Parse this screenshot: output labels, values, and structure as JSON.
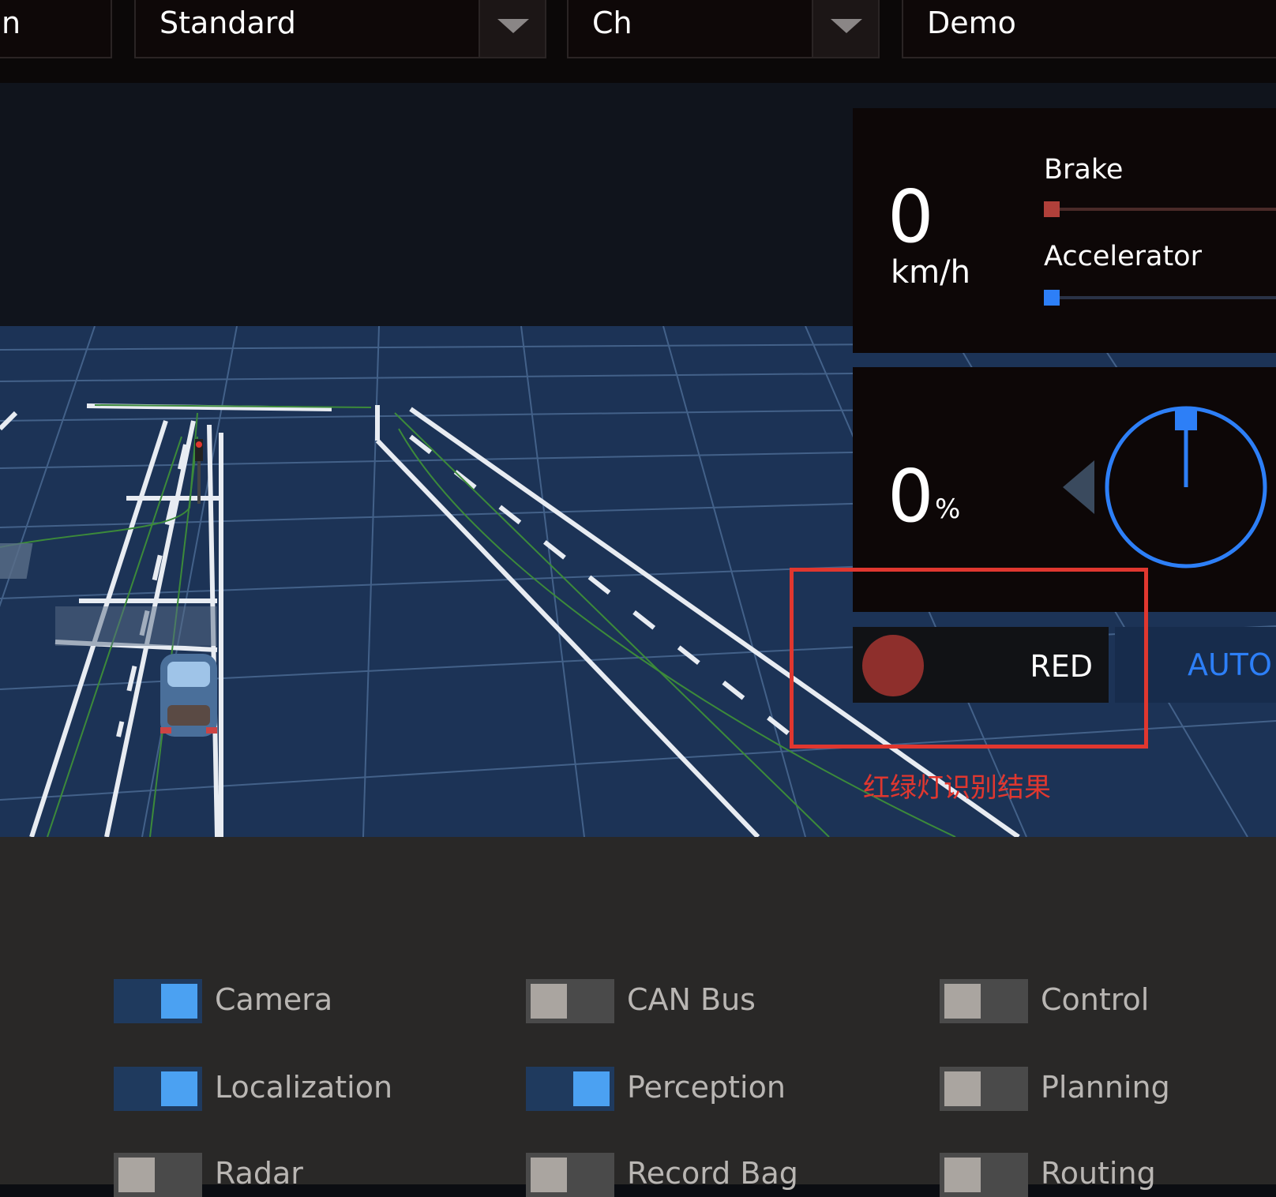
{
  "header": {
    "dropdowns": [
      {
        "id": "mode",
        "value": "n"
      },
      {
        "id": "vehicle",
        "value": "Standard"
      },
      {
        "id": "map",
        "value": "Ch"
      },
      {
        "id": "scenario",
        "value": "Demo"
      }
    ]
  },
  "dashboard": {
    "speed": {
      "value": "0",
      "unit": "km/h"
    },
    "brake": {
      "label": "Brake",
      "level": 0
    },
    "accelerator": {
      "label": "Accelerator",
      "level": 0
    },
    "steering": {
      "value": "0",
      "unit": "%"
    },
    "traffic_light": {
      "status": "RED",
      "color": "#8e2f2c"
    },
    "driving_mode": "AUTO"
  },
  "annotation": {
    "label": "红绿灯识别结果",
    "color": "#e0372f"
  },
  "modules": [
    {
      "name": "Camera",
      "on": true
    },
    {
      "name": "CAN Bus",
      "on": false
    },
    {
      "name": "Control",
      "on": false
    },
    {
      "name": "Localization",
      "on": true
    },
    {
      "name": "Perception",
      "on": true
    },
    {
      "name": "Planning",
      "on": false
    },
    {
      "name": "Radar",
      "on": false
    },
    {
      "name": "Record Bag",
      "on": false
    },
    {
      "name": "Routing",
      "on": false
    }
  ],
  "colors": {
    "accent_blue": "#2d7ff7",
    "brake_red": "#b0403a",
    "toggle_on": "#4ba1f2"
  }
}
